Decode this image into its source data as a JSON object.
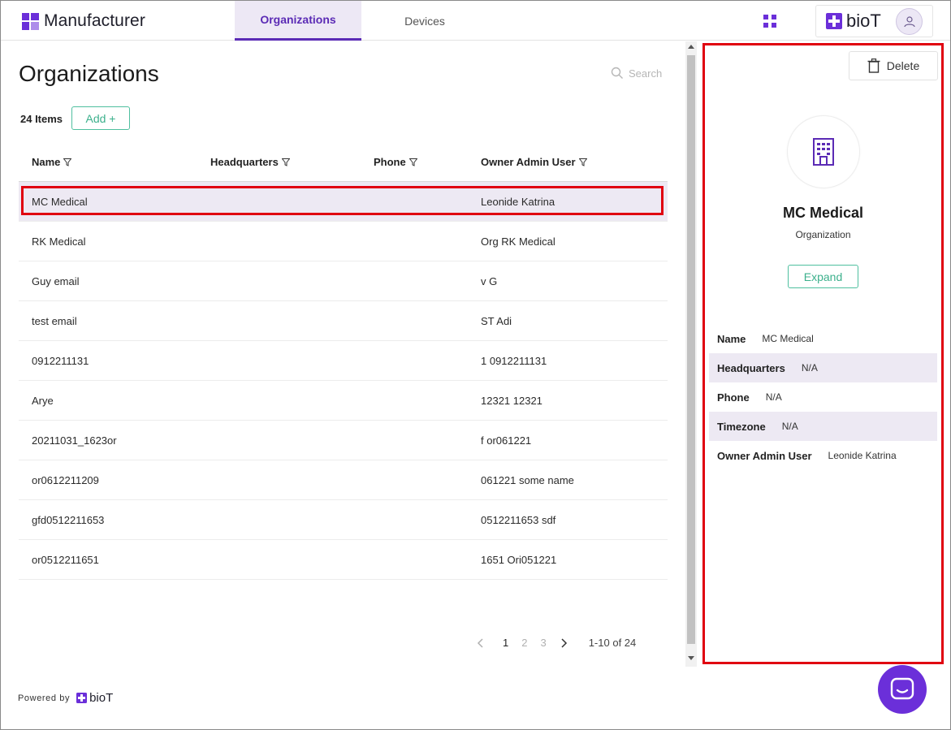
{
  "app": {
    "title": "Manufacturer",
    "brand_name": "bioT",
    "accent": "#5b2bb5",
    "green": "#3cb08c",
    "highlight": "#e00010"
  },
  "nav": {
    "tabs": [
      {
        "label": "Organizations",
        "active": true
      },
      {
        "label": "Devices",
        "active": false
      }
    ]
  },
  "page": {
    "title": "Organizations",
    "search_placeholder": "Search",
    "item_count": "24 Items",
    "add_label": "Add +"
  },
  "table": {
    "columns": [
      "Name",
      "Headquarters",
      "Phone",
      "Owner Admin User"
    ],
    "rows": [
      {
        "name": "MC Medical",
        "headquarters": "",
        "phone": "",
        "owner": "Leonide Katrina",
        "selected": true
      },
      {
        "name": "RK Medical",
        "headquarters": "",
        "phone": "",
        "owner": "Org RK Medical"
      },
      {
        "name": "Guy email",
        "headquarters": "",
        "phone": "",
        "owner": "v G"
      },
      {
        "name": "test email",
        "headquarters": "",
        "phone": "",
        "owner": "ST Adi"
      },
      {
        "name": "0912211131",
        "headquarters": "",
        "phone": "",
        "owner": "1 0912211131"
      },
      {
        "name": "Arye",
        "headquarters": "",
        "phone": "",
        "owner": "12321 12321"
      },
      {
        "name": "20211031_1623or",
        "headquarters": "",
        "phone": "",
        "owner": "f or061221"
      },
      {
        "name": "or0612211209",
        "headquarters": "",
        "phone": "",
        "owner": "061221 some name"
      },
      {
        "name": "gfd0512211653",
        "headquarters": "",
        "phone": "",
        "owner": "0512211653 sdf"
      },
      {
        "name": "or0512211651",
        "headquarters": "",
        "phone": "",
        "owner": "1651 Ori051221"
      }
    ]
  },
  "pagination": {
    "pages": [
      "1",
      "2",
      "3"
    ],
    "current": "1",
    "range": "1-10 of 24"
  },
  "details": {
    "delete_label": "Delete",
    "org_name": "MC Medical",
    "org_type": "Organization",
    "expand_label": "Expand",
    "fields": [
      {
        "key": "Name",
        "value": "MC Medical"
      },
      {
        "key": "Headquarters",
        "value": "N/A"
      },
      {
        "key": "Phone",
        "value": "N/A"
      },
      {
        "key": "Timezone",
        "value": "N/A"
      },
      {
        "key": "Owner Admin User",
        "value": "Leonide Katrina"
      }
    ]
  },
  "footer": {
    "powered_by": "Powered by",
    "brand": "bioT"
  }
}
